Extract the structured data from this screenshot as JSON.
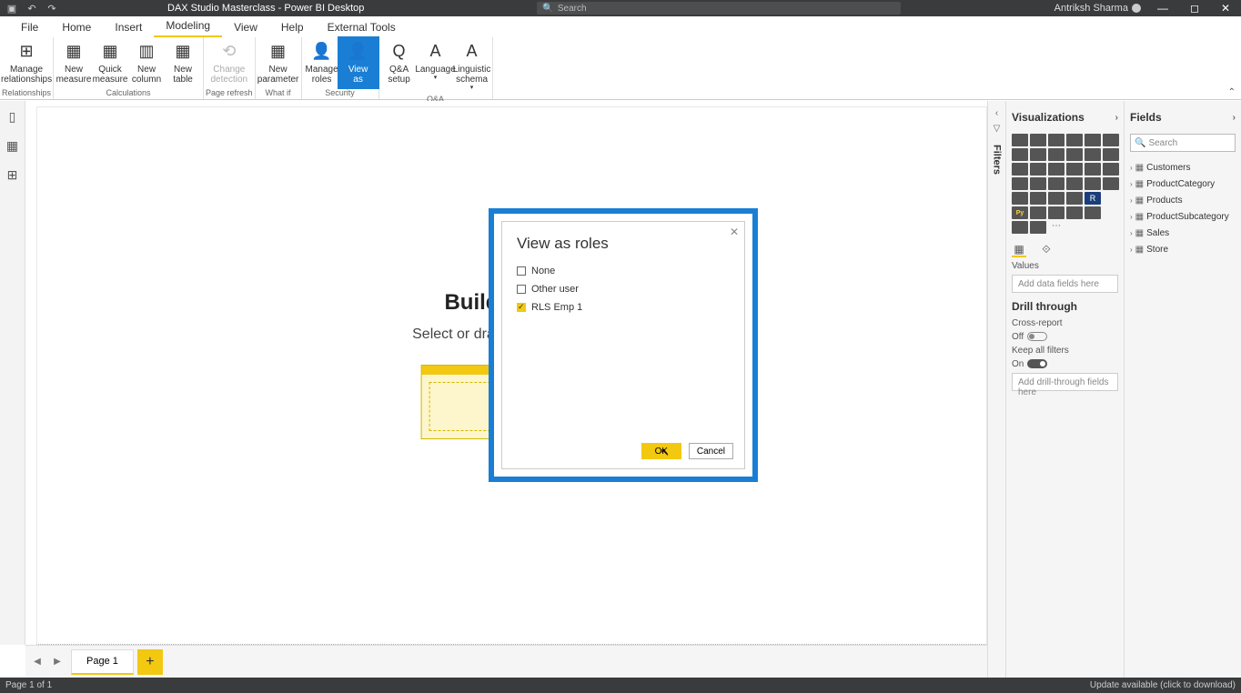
{
  "titlebar": {
    "title": "DAX Studio Masterclass - Power BI Desktop",
    "search_placeholder": "Search",
    "user": "Antriksh Sharma"
  },
  "ribbon_tabs": [
    "File",
    "Home",
    "Insert",
    "Modeling",
    "View",
    "Help",
    "External Tools"
  ],
  "ribbon_active_tab": "Modeling",
  "ribbon": {
    "groups": {
      "relationships": {
        "label": "Relationships",
        "manage": "Manage relationships"
      },
      "calculations": {
        "label": "Calculations",
        "new_measure": "New measure",
        "quick_measure": "Quick measure",
        "new_column": "New column",
        "new_table": "New table"
      },
      "page_refresh": {
        "label": "Page refresh",
        "change_detection": "Change detection"
      },
      "whatif": {
        "label": "What if",
        "new_parameter": "New parameter"
      },
      "security": {
        "label": "Security",
        "manage_roles": "Manage roles",
        "view_as": "View as"
      },
      "qa": {
        "label": "Q&A",
        "qa_setup": "Q&A setup",
        "language": "Language",
        "linguistic_schema": "Linguistic schema"
      }
    }
  },
  "canvas": {
    "heading": "Build visuals",
    "subheading": "Select or drag fields from the F"
  },
  "dialog": {
    "title": "View as roles",
    "options": [
      {
        "label": "None",
        "checked": false
      },
      {
        "label": "Other user",
        "checked": false
      },
      {
        "label": "RLS Emp 1",
        "checked": true
      }
    ],
    "ok": "OK",
    "cancel": "Cancel"
  },
  "page_tabs": {
    "page1": "Page 1"
  },
  "statusbar": {
    "left": "Page 1 of 1",
    "right": "Update available (click to download)"
  },
  "panes": {
    "filters_label": "Filters",
    "viz_header": "Visualizations",
    "values_label": "Values",
    "values_placeholder": "Add data fields here",
    "drill_header": "Drill through",
    "cross_report": "Cross-report",
    "off": "Off",
    "keep_filters": "Keep all filters",
    "on": "On",
    "drill_placeholder": "Add drill-through fields here",
    "fields_header": "Fields",
    "fields_search": "Search",
    "field_tables": [
      "Customers",
      "ProductCategory",
      "Products",
      "ProductSubcategory",
      "Sales",
      "Store"
    ]
  }
}
